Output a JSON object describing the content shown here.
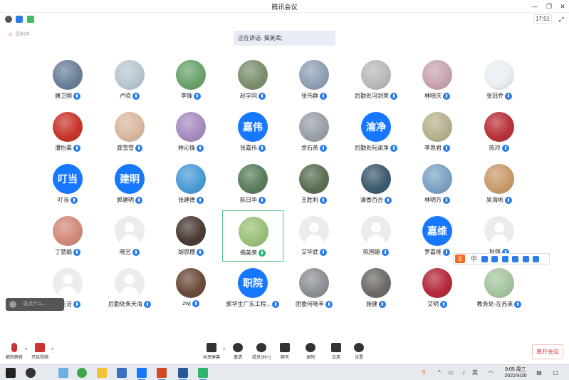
{
  "window": {
    "title": "腾讯会议",
    "time": "17:51"
  },
  "recording": "录制中",
  "speaking": "正在讲话: 揭英荣;",
  "accent": "#1677ff",
  "participants": [
    {
      "name": "唐卫国",
      "avatar": "photo",
      "color": "#6b7f9a"
    },
    {
      "name": "卢欢",
      "avatar": "photo",
      "color": "#b7c7cf"
    },
    {
      "name": "李锋",
      "avatar": "photo",
      "color": "#6aa26a"
    },
    {
      "name": "赵学问",
      "avatar": "photo",
      "color": "#7a8f6d"
    },
    {
      "name": "张伟群",
      "avatar": "photo",
      "color": "#8ea0b3"
    },
    {
      "name": "后勤处冯剑荣",
      "avatar": "photo",
      "color": "#b9b9b9"
    },
    {
      "name": "林晓庆",
      "avatar": "photo",
      "color": "#c9a4ae"
    },
    {
      "name": "张冠乔",
      "avatar": "photo",
      "color": "#e8eef2"
    },
    {
      "name": "潘怡渠",
      "avatar": "photo",
      "color": "#c8342a"
    },
    {
      "name": "龚雪雪",
      "avatar": "photo",
      "color": "#d9b8a0"
    },
    {
      "name": "林沁锋",
      "avatar": "photo",
      "color": "#a78bbf"
    },
    {
      "name": "张嘉伟",
      "avatar": "text",
      "text": "嘉伟"
    },
    {
      "name": "余石燕",
      "avatar": "photo",
      "color": "#9aa0a8"
    },
    {
      "name": "后勤处阮渝净",
      "avatar": "text",
      "text": "渝净"
    },
    {
      "name": "李思君",
      "avatar": "photo",
      "color": "#b6b28f"
    },
    {
      "name": "陈玲",
      "avatar": "photo",
      "color": "#b8313a"
    },
    {
      "name": "叮当",
      "avatar": "text",
      "text": "叮当"
    },
    {
      "name": "郭建明",
      "avatar": "text",
      "text": "建明"
    },
    {
      "name": "张建德",
      "avatar": "photo",
      "color": "#4a9bd6"
    },
    {
      "name": "陈日华",
      "avatar": "photo",
      "color": "#5a7d5a"
    },
    {
      "name": "王胜利",
      "avatar": "photo",
      "color": "#5b6e52"
    },
    {
      "name": "清香百合",
      "avatar": "photo",
      "color": "#3d5a6e"
    },
    {
      "name": "林明方",
      "avatar": "photo",
      "color": "#7da2c4"
    },
    {
      "name": "吴海彬",
      "avatar": "photo",
      "color": "#c99a6a"
    },
    {
      "name": "丁慧娟",
      "avatar": "photo",
      "color": "#d28a7a"
    },
    {
      "name": "晓艺",
      "avatar": "grey"
    },
    {
      "name": "胡思穗",
      "avatar": "photo",
      "color": "#4a3a36"
    },
    {
      "name": "揭英荣",
      "avatar": "photo",
      "color": "#9cc07a",
      "active": true
    },
    {
      "name": "艾华武",
      "avatar": "grey"
    },
    {
      "name": "陈国雄",
      "avatar": "grey"
    },
    {
      "name": "罗嘉维",
      "avatar": "text",
      "text": "嘉维"
    },
    {
      "name": "耿强",
      "avatar": "grey"
    },
    {
      "name": "曾玉洁",
      "avatar": "grey"
    },
    {
      "name": "后勤处朱天海",
      "avatar": "grey"
    },
    {
      "name": "zwj",
      "avatar": "photo",
      "color": "#6b4a3a"
    },
    {
      "name": "郭华生广东工程...",
      "avatar": "text",
      "text": "职院"
    },
    {
      "name": "团委何晓丰",
      "avatar": "photo",
      "color": "#8c8f94"
    },
    {
      "name": "施健",
      "avatar": "photo",
      "color": "#6d6a66"
    },
    {
      "name": "艾明",
      "avatar": "photo",
      "color": "#b5283a"
    },
    {
      "name": "教务处-左苏英",
      "avatar": "photo",
      "color": "#a6c4a0"
    }
  ],
  "chat_placeholder": "说点什么...",
  "ime": {
    "label": "中"
  },
  "toolbar": {
    "mute": "解除静音",
    "video": "开启视频",
    "share": "共享屏幕",
    "invite": "邀请",
    "members": "成员(99+)",
    "chat": "聊天",
    "record": "录制",
    "apps": "应用",
    "settings": "设置",
    "leave": "离开会议"
  },
  "taskbar": {
    "time": "9:05 周三",
    "date": "2022/4/20"
  }
}
